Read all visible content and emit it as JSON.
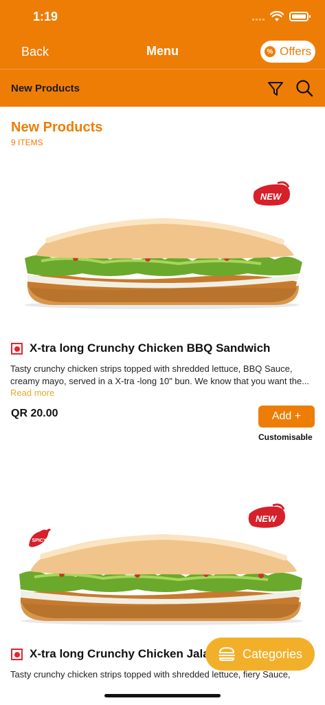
{
  "status_bar": {
    "time": "1:19"
  },
  "nav": {
    "back_label": "Back",
    "title": "Menu",
    "offers_label": "Offers"
  },
  "subheader": {
    "title": "New Products"
  },
  "section": {
    "title": "New Products",
    "count": "9 ITEMS"
  },
  "products": [
    {
      "badge": "NEW",
      "name": "X-tra long Crunchy Chicken BBQ Sandwich",
      "description": "Tasty crunchy chicken strips topped with shredded lettuce, BBQ Sauce, creamy mayo, served in a X-tra -long 10\" bun. We know that you want the...",
      "read_more": "Read more",
      "price": "QR 20.00",
      "add_label": "Add +",
      "note": "Customisable"
    },
    {
      "badge": "NEW",
      "spicy_badge": "SPICY",
      "name": "X-tra long Crunchy Chicken Jalapeño",
      "description": "Tasty crunchy chicken strips topped with shredded lettuce, fiery Sauce,"
    }
  ],
  "categories_button": {
    "label": "Categories"
  },
  "colors": {
    "brand": "#EE7D05",
    "accent": "#F2B02A",
    "nonveg": "#e3242b"
  }
}
